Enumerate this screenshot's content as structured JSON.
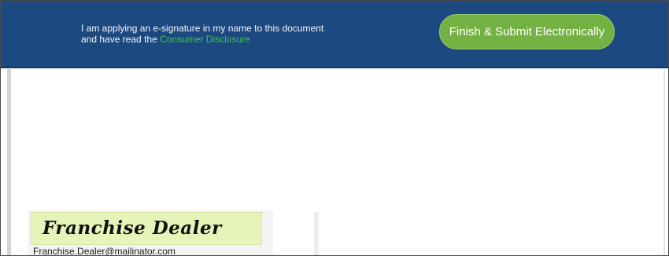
{
  "header": {
    "consent_text": "I am applying an e-signature in my name to this document and have read the",
    "consent_link": "Consumer Disclosure",
    "finish_button_label": "Finish & Submit Electronically"
  },
  "signature": {
    "name": "Franchise Dealer",
    "email": "Franchise.Dealer@mailinator.com"
  },
  "colors": {
    "header_background": "#1c4a80",
    "link": "#3fc24a",
    "finish_button": "#74b143",
    "signature_field": "#e5f4b8"
  }
}
